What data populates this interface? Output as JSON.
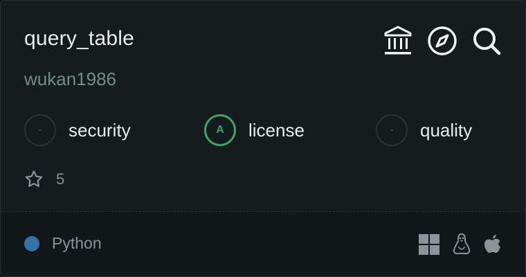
{
  "repo": {
    "name": "query_table",
    "owner": "wukan1986",
    "stars": "5"
  },
  "actions": [
    {
      "icon": "bank-icon"
    },
    {
      "icon": "compass-icon"
    },
    {
      "icon": "search-icon"
    }
  ],
  "scores": [
    {
      "grade": "-",
      "label": "security"
    },
    {
      "grade": "A",
      "label": "license"
    },
    {
      "grade": "-",
      "label": "quality"
    }
  ],
  "language": {
    "name": "Python",
    "color": "#3572A5"
  },
  "platforms": [
    "windows-icon",
    "linux-icon",
    "apple-icon"
  ],
  "colors": {
    "accent_green": "#3fa26b",
    "owner": "#6f8f86"
  }
}
